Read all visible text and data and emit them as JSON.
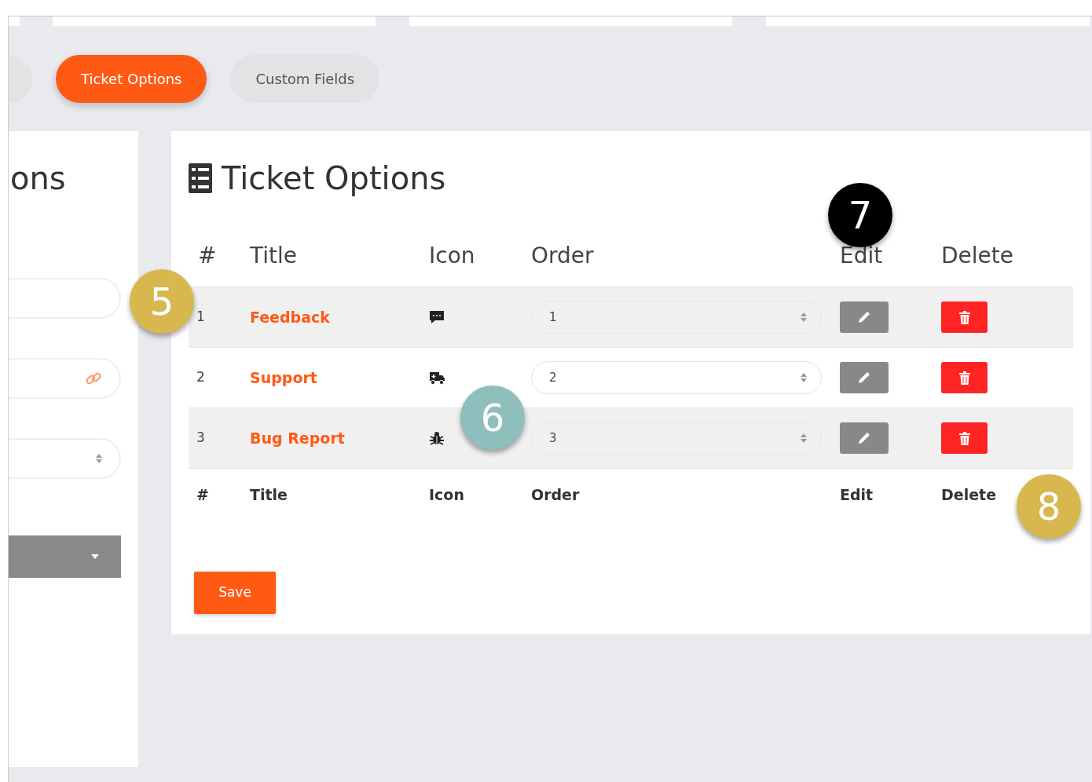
{
  "tabs": [
    {
      "selected": false
    },
    {
      "label": "Ticket Options",
      "selected": true
    },
    {
      "label": "Custom Fields",
      "selected": false
    }
  ],
  "side_panel": {
    "title": "ons",
    "fields": [
      {
        "kind": "text"
      },
      {
        "kind": "link"
      },
      {
        "kind": "number"
      },
      {
        "kind": "dropdown"
      }
    ]
  },
  "options_card": {
    "title": "Ticket Options",
    "columns": [
      "#",
      "Title",
      "Icon",
      "Order",
      "Edit",
      "Delete"
    ],
    "rows": [
      {
        "number": "1",
        "title": "Feedback",
        "kind": "comment",
        "order": "1"
      },
      {
        "number": "2",
        "title": "Support",
        "kind": "truck",
        "order": "2"
      },
      {
        "number": "3",
        "title": "Bug Report",
        "kind": "bug",
        "order": "3"
      }
    ],
    "footer_columns": [
      "#",
      "Title",
      "Icon",
      "Order",
      "Edit",
      "Delete"
    ],
    "save_button": "Save"
  },
  "callouts": [
    {
      "label": "5",
      "color": "#d8b84e"
    },
    {
      "label": "6",
      "color": "#8ebfbd"
    },
    {
      "label": "7",
      "color": "#000000"
    },
    {
      "label": "8",
      "color": "#d8b84e"
    }
  ]
}
